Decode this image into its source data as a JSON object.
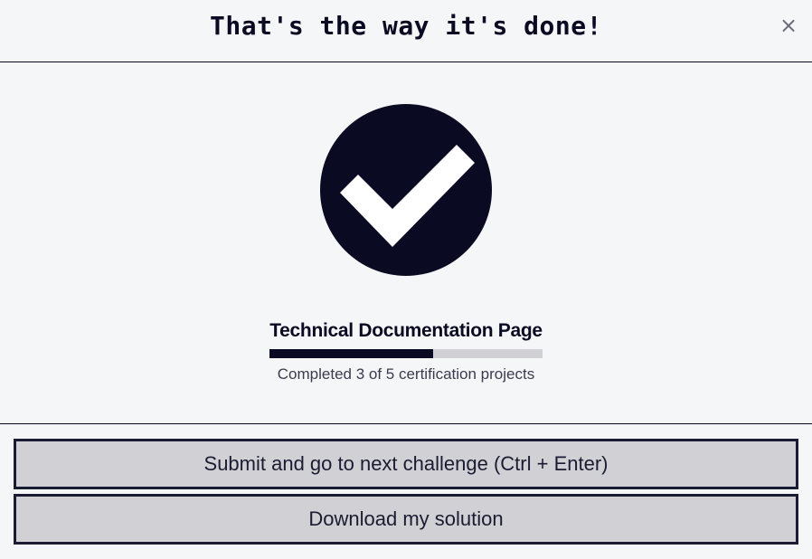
{
  "modal": {
    "title": "That's the way it's done!",
    "close_label": "×"
  },
  "project": {
    "title": "Technical Documentation Page",
    "completed": 3,
    "total": 5,
    "progress_fraction": 0.6,
    "progress_text": "Completed 3 of 5 certification projects"
  },
  "icons": {
    "success": "check-circle-icon",
    "close": "close-icon"
  },
  "buttons": {
    "submit_label": "Submit and go to next challenge (Ctrl + Enter)",
    "download_label": "Download my solution"
  },
  "colors": {
    "primary": "#0a0a23",
    "track": "#d0d0d5",
    "background": "#f5f6f7"
  }
}
